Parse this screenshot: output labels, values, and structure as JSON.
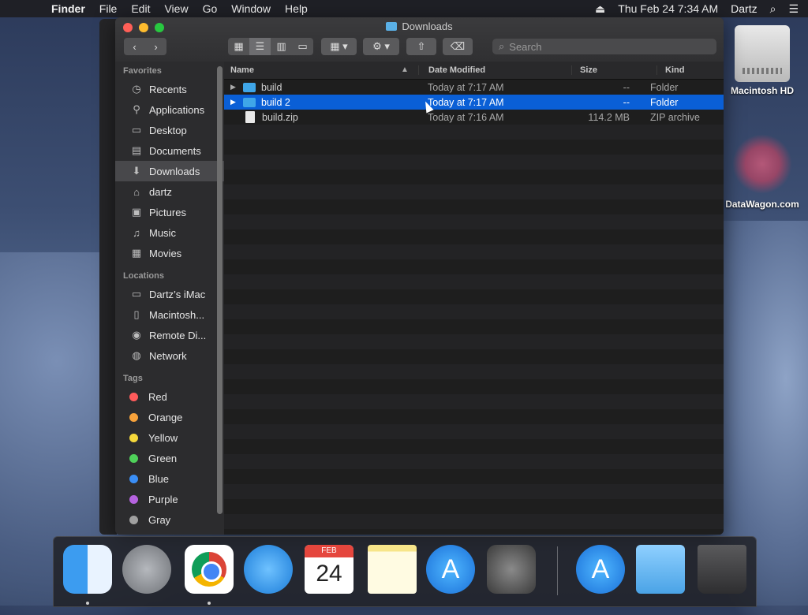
{
  "menubar": {
    "apple": "",
    "items": [
      "Finder",
      "File",
      "Edit",
      "View",
      "Go",
      "Window",
      "Help"
    ],
    "datetime": "Thu Feb 24  7:34 AM",
    "user": "Dartz"
  },
  "desktop": {
    "icons": [
      {
        "label": "Macintosh HD"
      },
      {
        "label": "DataWagon.com"
      }
    ]
  },
  "window": {
    "title": "Downloads",
    "search_placeholder": "Search"
  },
  "sidebar": {
    "favorites_header": "Favorites",
    "favorites": [
      {
        "label": "Recents",
        "icon": "recents-icon"
      },
      {
        "label": "Applications",
        "icon": "applications-icon"
      },
      {
        "label": "Desktop",
        "icon": "desktop-icon"
      },
      {
        "label": "Documents",
        "icon": "documents-icon"
      },
      {
        "label": "Downloads",
        "icon": "downloads-icon"
      },
      {
        "label": "dartz",
        "icon": "home-icon"
      },
      {
        "label": "Pictures",
        "icon": "pictures-icon"
      },
      {
        "label": "Music",
        "icon": "music-icon"
      },
      {
        "label": "Movies",
        "icon": "movies-icon"
      }
    ],
    "locations_header": "Locations",
    "locations": [
      {
        "label": "Dartz’s iMac",
        "icon": "computer-icon"
      },
      {
        "label": "Macintosh...",
        "icon": "hard-drive-icon"
      },
      {
        "label": "Remote Di...",
        "icon": "remote-disc-icon"
      },
      {
        "label": "Network",
        "icon": "network-icon"
      }
    ],
    "tags_header": "Tags",
    "tags": [
      {
        "label": "Red",
        "color": "#ff5b5b"
      },
      {
        "label": "Orange",
        "color": "#f7a23b"
      },
      {
        "label": "Yellow",
        "color": "#f5d83b"
      },
      {
        "label": "Green",
        "color": "#4fd15a"
      },
      {
        "label": "Blue",
        "color": "#3a8ef6"
      },
      {
        "label": "Purple",
        "color": "#b663e0"
      },
      {
        "label": "Gray",
        "color": "#a0a0a0"
      }
    ]
  },
  "columns": {
    "name": "Name",
    "date": "Date Modified",
    "size": "Size",
    "kind": "Kind"
  },
  "files": [
    {
      "name": "build",
      "date": "Today at 7:17 AM",
      "size": "--",
      "kind": "Folder"
    },
    {
      "name": "build 2",
      "date": "Today at 7:17 AM",
      "size": "--",
      "kind": "Folder"
    },
    {
      "name": "build.zip",
      "date": "Today at 7:16 AM",
      "size": "114.2 MB",
      "kind": "ZIP archive"
    }
  ],
  "dock": {
    "calendar_month": "FEB",
    "calendar_day": "24"
  }
}
